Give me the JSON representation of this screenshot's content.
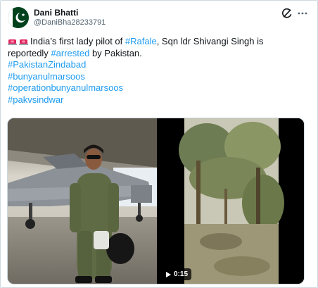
{
  "author": {
    "display_name": "Dani Bhatti",
    "handle": "@DaniBha28233791",
    "avatar_icon": "pakistan-flag-avatar"
  },
  "tweet": {
    "emoji": "siren-emoji",
    "line1_text": "India’s first lady pilot of ",
    "line1_link": "#Rafale",
    "line1_rest": ", Sqn ldr Shivangi Singh is",
    "line2_text": "reportedly ",
    "line2_link": "#arrested",
    "line2_rest": " by Pakistan.",
    "hashtags": [
      "#PakistanZindabad",
      "#bunyanulmarsoos",
      "#operationbunyanulmarsoos",
      "#pakvsindwar"
    ]
  },
  "media": {
    "left_image": "woman-pilot-in-flight-suit-beside-fighter-jet",
    "right_video": "forest-scene-video",
    "video_duration": "0:15"
  },
  "colors": {
    "link": "#1d9bf0",
    "text": "#0f1419",
    "secondary": "#536471",
    "flag_green": "#01411c"
  }
}
